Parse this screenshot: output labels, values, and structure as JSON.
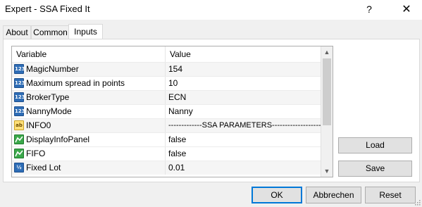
{
  "window": {
    "title": "Expert - SSA Fixed It",
    "help": "?",
    "close": "✕"
  },
  "tabs": [
    {
      "label": "About"
    },
    {
      "label": "Common"
    },
    {
      "label": "Inputs"
    }
  ],
  "grid": {
    "headers": {
      "variable": "Variable",
      "value": "Value"
    },
    "rows": [
      {
        "icon": "123",
        "type": "int",
        "variable": "MagicNumber",
        "value": "154"
      },
      {
        "icon": "123",
        "type": "int",
        "variable": "Maximum spread in points",
        "value": "10"
      },
      {
        "icon": "123",
        "type": "int",
        "variable": "BrokerType",
        "value": "ECN"
      },
      {
        "icon": "123",
        "type": "int",
        "variable": "NannyMode",
        "value": "Nanny"
      },
      {
        "icon": "ab",
        "type": "string",
        "variable": "INFO0",
        "value": "-------------SSA PARAMETERS-------------------"
      },
      {
        "icon": "bool-icon",
        "type": "bool",
        "variable": "DisplayInfoPanel",
        "value": "false"
      },
      {
        "icon": "bool-icon",
        "type": "bool",
        "variable": "FIFO",
        "value": "false"
      },
      {
        "icon": "½",
        "type": "double",
        "variable": "Fixed Lot",
        "value": "0.01"
      }
    ]
  },
  "buttons": {
    "load": "Load",
    "save": "Save",
    "ok": "OK",
    "cancel": "Abbrechen",
    "reset": "Reset"
  }
}
